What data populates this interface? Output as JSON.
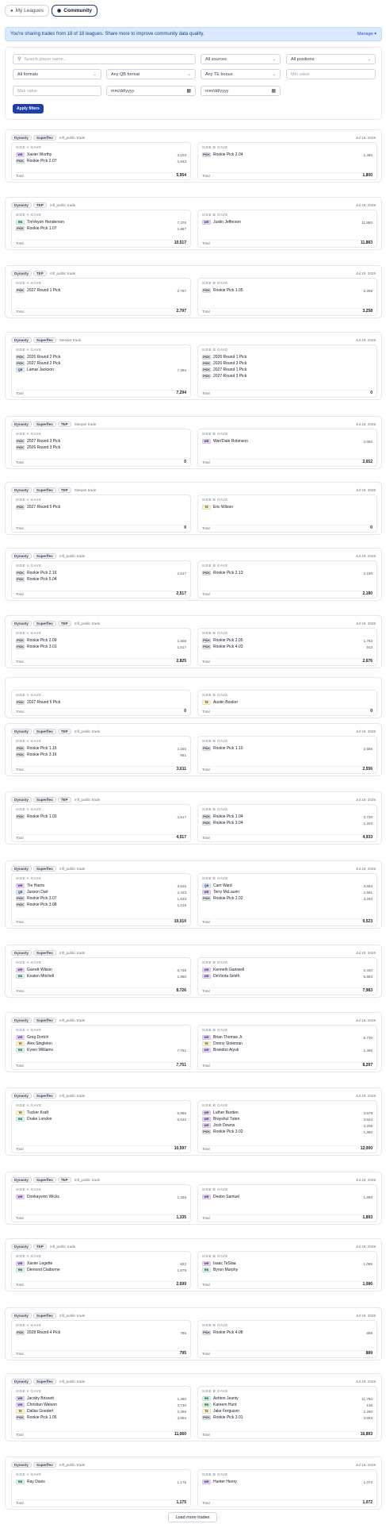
{
  "tabs": [
    {
      "label": "My Leagues",
      "icon": "person-icon",
      "active": false
    },
    {
      "label": "Community",
      "icon": "globe-icon",
      "active": true
    }
  ],
  "banner": {
    "text": "You're sharing trades from 18 of 18 leagues. Share more to improve community data quality.",
    "manage": "Manage ▾"
  },
  "filters": {
    "search_placeholder": "Search player name...",
    "sources": "All sources",
    "positions": "All positions",
    "formats": "All formats",
    "qb_format": "Any QB format",
    "te_bonus": "Any TE bonus",
    "min_placeholder": "Min value",
    "max_placeholder": "Max value",
    "date1": "mm/dd/yyyy",
    "date2": "mm/dd/yyyy",
    "apply": "Apply filters"
  },
  "colors": {
    "WR": "#e9d5ff",
    "RB": "#d1fae5",
    "QB": "#dbeafe",
    "TE": "#fef3c7",
    "PICK": "#e5e7eb"
  },
  "labels": {
    "side_a": "SIDE A GAVE",
    "side_b": "SIDE B GAVE",
    "total": "Total"
  },
  "load_more": "Load more trades",
  "trades": [
    {
      "badges": [
        "Dynasty",
        "Superflex"
      ],
      "source": "mfl_public trade",
      "date": "Jul 18, 2026",
      "a": [
        [
          "WR",
          "Xavier Worthy",
          "3,103"
        ],
        [
          "PICK",
          "Rookie Pick 2.07",
          "2,843"
        ]
      ],
      "a_total": "5,954",
      "b": [
        [
          "PICK",
          "Rookie Pick 2.04",
          "1,480"
        ]
      ],
      "b_total": "1,800"
    },
    {
      "badges": [
        "Dynasty",
        "TEP"
      ],
      "source": "mfl_public trade",
      "date": "Jul 18, 2026",
      "a": [
        [
          "RB",
          "TreVeyon Henderson",
          "7,376"
        ],
        [
          "PICK",
          "Rookie Pick 1.07",
          "1,867"
        ]
      ],
      "a_total": "10,517",
      "b": [
        [
          "WR",
          "Justin Jefferson",
          "11,883"
        ]
      ],
      "b_total": "11,883"
    },
    {
      "badges": [
        "Dynasty",
        "TEP"
      ],
      "source": "mfl_public trade",
      "date": "Jul 18, 2026",
      "a": [
        [
          "PICK",
          "2027 Round 1 Pick",
          "2,797"
        ]
      ],
      "a_total": "2,797",
      "b": [
        [
          "PICK",
          "Rookie Pick 1.05",
          "3,258"
        ]
      ],
      "b_total": "3,258"
    },
    {
      "badges": [
        "Dynasty",
        "Superflex"
      ],
      "source": "Sleeper trade",
      "date": "Jul 18, 2026",
      "a": [
        [
          "PICK",
          "2026 Round 2 Pick",
          ""
        ],
        [
          "PICK",
          "2027 Round 2 Pick",
          ""
        ],
        [
          "QB",
          "Lamar Jackson",
          "7,294"
        ]
      ],
      "a_total": "7,294",
      "b": [
        [
          "PICK",
          "2026 Round 1 Pick",
          ""
        ],
        [
          "PICK",
          "2026 Round 3 Pick",
          ""
        ],
        [
          "PICK",
          "2027 Round 1 Pick",
          ""
        ],
        [
          "PICK",
          "2027 Round 3 Pick",
          ""
        ]
      ],
      "b_total": "0"
    },
    {
      "badges": [
        "Dynasty",
        "Superflex",
        "TEP"
      ],
      "source": "Sleeper trade",
      "date": "Jul 18, 2026",
      "a": [
        [
          "PICK",
          "2027 Round 3 Pick",
          ""
        ],
        [
          "PICK",
          "2026 Round 3 Pick",
          ""
        ]
      ],
      "a_total": "0",
      "b": [
        [
          "WR",
          "Wan'Dale Robinson",
          "2,652"
        ]
      ],
      "b_total": "2,652"
    },
    {
      "badges": [
        "Dynasty",
        "Superflex",
        "TEP"
      ],
      "source": "Sleeper trade",
      "date": "Jul 18, 2026",
      "a": [
        [
          "PICK",
          "2027 Round 5 Pick",
          ""
        ]
      ],
      "a_total": "0",
      "b": [
        [
          "TE",
          "Eric Wilson",
          ""
        ]
      ],
      "b_total": "0"
    },
    {
      "badges": [
        "Dynasty",
        "Superflex"
      ],
      "source": "mfl_public trade",
      "date": "Jul 18, 2026",
      "a": [
        [
          "PICK",
          "Rookie Pick 2.16",
          "2,517"
        ],
        [
          "PICK",
          "Rookie Pick 5.04",
          ""
        ]
      ],
      "a_total": "2,517",
      "b": [
        [
          "PICK",
          "Rookie Pick 2.13",
          "2,180"
        ]
      ],
      "b_total": "2,180"
    },
    {
      "badges": [
        "Dynasty",
        "Superflex",
        "TEP"
      ],
      "source": "mfl_public trade",
      "date": "Jul 18, 2026",
      "a": [
        [
          "PICK",
          "Rookie Pick 2.09",
          "1,308"
        ],
        [
          "PICK",
          "Rookie Pick 3.01",
          "1,517"
        ]
      ],
      "a_total": "2,825",
      "b": [
        [
          "PICK",
          "Rookie Pick 2.05",
          "1,763"
        ],
        [
          "PICK",
          "Rookie Pick 4.03",
          "913"
        ]
      ],
      "b_total": "2,676"
    },
    {
      "badges": [],
      "source": "",
      "date": "",
      "a": [
        [
          "PICK",
          "2027 Round 5 Pick",
          ""
        ]
      ],
      "a_total": "0",
      "b": [
        [
          "TE",
          "Austin Booker",
          ""
        ]
      ],
      "b_total": "0"
    },
    {
      "badges": [
        "Dynasty",
        "Superflex",
        "TEP"
      ],
      "source": "mfl_public trade",
      "date": "Jul 18, 2026",
      "a": [
        [
          "PICK",
          "Rookie Pick 1.15",
          "2,150"
        ],
        [
          "PICK",
          "Rookie Pick 3.16",
          "861"
        ]
      ],
      "a_total": "3,011",
      "b": [
        [
          "PICK",
          "Rookie Pick 1.10",
          "2,556"
        ]
      ],
      "b_total": "2,556"
    },
    {
      "badges": [
        "Dynasty",
        "Superflex",
        "TEP"
      ],
      "source": "mfl_public trade",
      "date": "Jul 18, 2026",
      "a": [
        [
          "PICK",
          "Rookie Pick 1.03",
          "4,517"
        ]
      ],
      "a_total": "4,517",
      "b": [
        [
          "PICK",
          "Rookie Pick 1.04",
          "3,730"
        ],
        [
          "PICK",
          "Rookie Pick 3.04",
          "1,203"
        ]
      ],
      "b_total": "4,933"
    },
    {
      "badges": [
        "Dynasty",
        "Superflex"
      ],
      "source": "mfl_public trade",
      "date": "Jul 18, 2026",
      "a": [
        [
          "WR",
          "Tre Harris",
          "3,526"
        ],
        [
          "QB",
          "Jaxson Dart",
          "3,423"
        ],
        [
          "PICK",
          "Rookie Pick 3.07",
          "1,843"
        ],
        [
          "PICK",
          "Rookie Pick 3.08",
          "1,218"
        ]
      ],
      "a_total": "10,010",
      "b": [
        [
          "QB",
          "Cam Ward",
          "3,594"
        ],
        [
          "WR",
          "Terry McLaurin",
          "2,581"
        ],
        [
          "PICK",
          "Rookie Pick 2.02",
          "3,283"
        ]
      ],
      "b_total": "9,523"
    },
    {
      "badges": [
        "Dynasty",
        "Superflex"
      ],
      "source": "mfl_public trade",
      "date": "Jul 18, 2026",
      "a": [
        [
          "WR",
          "Garrett Wilson",
          "6,736"
        ],
        [
          "RB",
          "Keaton Mitchell",
          "1,990"
        ]
      ],
      "a_total": "8,726",
      "b": [
        [
          "WR",
          "Kenneth Gainwell",
          "2,440"
        ],
        [
          "WR",
          "DeVonta Smith",
          "5,853"
        ]
      ],
      "b_total": "7,983"
    },
    {
      "badges": [
        "Dynasty",
        "Superflex"
      ],
      "source": "mfl_public trade",
      "date": "Jul 18, 2026",
      "a": [
        [
          "WR",
          "Greg Dortch",
          ""
        ],
        [
          "TE",
          "Alex Singleton",
          ""
        ],
        [
          "RB",
          "Kyren Williams",
          "7,751"
        ]
      ],
      "a_total": "7,751",
      "b": [
        [
          "WR",
          "Brian Thomas Jr.",
          "6,730"
        ],
        [
          "TE",
          "Donny Stoleman",
          ""
        ],
        [
          "WR",
          "Brandon Aiyuk",
          "1,496"
        ]
      ],
      "b_total": "8,297"
    },
    {
      "badges": [
        "Dynasty",
        "Superflex"
      ],
      "source": "mfl_public trade",
      "date": "Jul 18, 2026",
      "a": [
        [
          "TE",
          "Tucker Kraft",
          "5,865"
        ],
        [
          "RB",
          "Drake London",
          "8,532"
        ]
      ],
      "a_total": "10,597",
      "b": [
        [
          "WR",
          "Luther Burden",
          "3,679"
        ],
        [
          "WR",
          "Brayshul Tuten",
          "3,624"
        ],
        [
          "WR",
          "Josh Downs",
          "3,208"
        ],
        [
          "PICK",
          "Rookie Pick 3.02",
          "1,850"
        ]
      ],
      "b_total": "12,000"
    },
    {
      "badges": [
        "Dynasty",
        "Superflex",
        "TEP"
      ],
      "source": "mfl_public trade",
      "date": "Jul 18, 2026",
      "a": [
        [
          "WR",
          "Donkayvion Wicks",
          "1,335"
        ]
      ],
      "a_total": "1,335",
      "b": [
        [
          "WR",
          "Deebo Samuel",
          "1,893"
        ]
      ],
      "b_total": "1,893"
    },
    {
      "badges": [
        "Dynasty",
        "TEP"
      ],
      "source": "mfl_public trade",
      "date": "Jul 18, 2026",
      "a": [
        [
          "WR",
          "Xavier Legette",
          "822"
        ],
        [
          "RB",
          "Demond Claiborne",
          "1,878"
        ]
      ],
      "a_total": "2,699",
      "b": [
        [
          "WR",
          "Isaac TeSlaa",
          "1,086"
        ],
        [
          "RB",
          "Byron Murphy",
          ""
        ]
      ],
      "b_total": "1,086"
    },
    {
      "badges": [
        "Dynasty",
        "Superflex"
      ],
      "source": "mfl_public trade",
      "date": "Jul 18, 2026",
      "a": [
        [
          "PICK",
          "2028 Round 4 Pick",
          "795"
        ]
      ],
      "a_total": "795",
      "b": [
        [
          "PICK",
          "Rookie Pick 4.08",
          "889"
        ]
      ],
      "b_total": "889"
    },
    {
      "badges": [
        "Dynasty",
        "Superflex"
      ],
      "source": "mfl_public trade",
      "date": "Jul 18, 2026",
      "a": [
        [
          "WR",
          "Jacoby Brissett",
          "1,480"
        ],
        [
          "WR",
          "Christian Watson",
          "3,730"
        ],
        [
          "TE",
          "Dallas Goedert",
          "2,256"
        ],
        [
          "PICK",
          "Rookie Pick 1.05",
          "3,594"
        ]
      ],
      "a_total": "11,060",
      "b": [
        [
          "RB",
          "Ashton Jeanty",
          "11,784"
        ],
        [
          "RB",
          "Kareem Hunt",
          "136"
        ],
        [
          "TE",
          "Jake Ferguson",
          "1,280"
        ],
        [
          "PICK",
          "Rookie Pick 3.01",
          "3,693"
        ]
      ],
      "b_total": "16,893"
    },
    {
      "badges": [
        "Dynasty",
        "Superflex"
      ],
      "source": "mfl_public trade",
      "date": "Jul 18, 2026",
      "a": [
        [
          "RB",
          "Ray Davis",
          "1,175"
        ]
      ],
      "a_total": "1,175",
      "b": [
        [
          "WR",
          "Hunter Henry",
          "1,072"
        ]
      ],
      "b_total": "1,072"
    }
  ]
}
